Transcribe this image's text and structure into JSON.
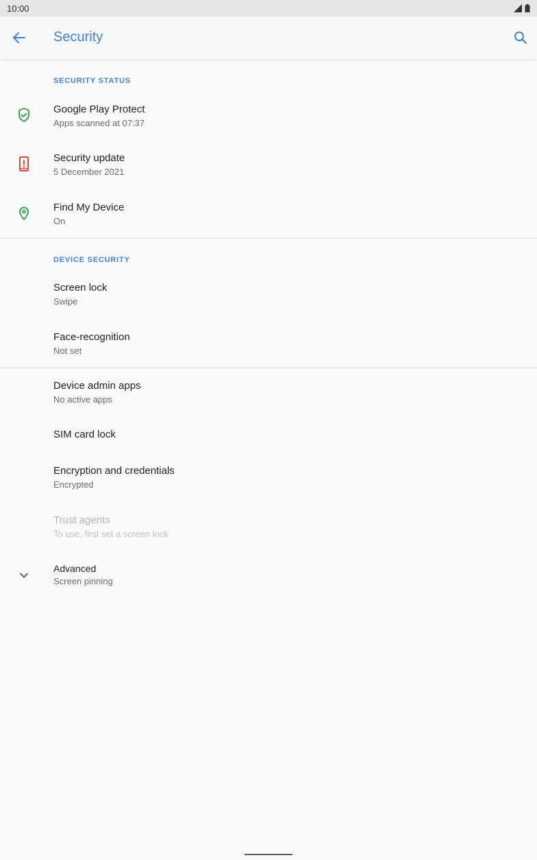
{
  "status_bar": {
    "time": "10:00"
  },
  "app_bar": {
    "title": "Security"
  },
  "sections": {
    "security_status": "SECURITY STATUS",
    "device_security": "DEVICE SECURITY"
  },
  "items": {
    "play_protect": {
      "title": "Google Play Protect",
      "summary": "Apps scanned at 07:37",
      "icon": "shield-check-icon"
    },
    "security_update": {
      "title": "Security update",
      "summary": "5 December 2021",
      "icon": "phone-alert-icon"
    },
    "find_device": {
      "title": "Find My Device",
      "summary": "On",
      "icon": "location-pin-icon"
    },
    "screen_lock": {
      "title": "Screen lock",
      "summary": "Swipe"
    },
    "face_recognition": {
      "title": "Face-recognition",
      "summary": "Not set"
    },
    "device_admin": {
      "title": "Device admin apps",
      "summary": "No active apps"
    },
    "sim_lock": {
      "title": "SIM card lock"
    },
    "encryption": {
      "title": "Encryption and credentials",
      "summary": "Encrypted"
    },
    "trust_agents": {
      "title": "Trust agents",
      "summary": "To use, first set a screen lock"
    },
    "advanced": {
      "title": "Advanced",
      "summary": "Screen pinning",
      "icon": "chevron-down-icon"
    }
  },
  "colors": {
    "accent": "#3b82e0",
    "safe_green": "#34a853",
    "alert_red": "#ea4335"
  }
}
